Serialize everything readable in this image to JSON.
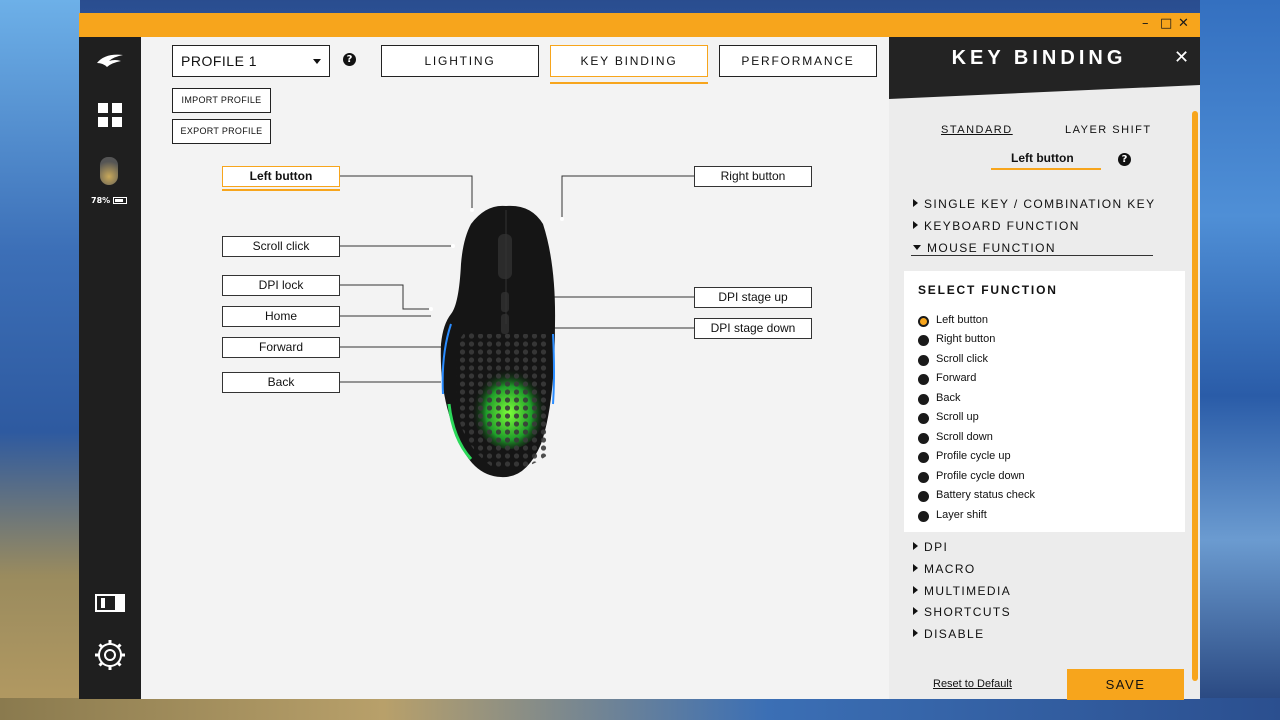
{
  "colors": {
    "accent": "#f7a51c",
    "sidebar": "#1f1f1f",
    "panel_header": "#232323"
  },
  "sidebar": {
    "battery_text": "78%"
  },
  "profile": {
    "selected": "PROFILE 1",
    "import_label": "IMPORT PROFILE",
    "export_label": "EXPORT PROFILE"
  },
  "tabs": [
    {
      "label": "LIGHTING"
    },
    {
      "label": "KEY BINDING"
    },
    {
      "label": "PERFORMANCE"
    }
  ],
  "buttons": {
    "left_button": "Left button",
    "scroll_click": "Scroll click",
    "dpi_lock": "DPI lock",
    "home": "Home",
    "forward": "Forward",
    "back": "Back",
    "right_button": "Right button",
    "dpi_stage_up": "DPI stage up",
    "dpi_stage_down": "DPI stage down"
  },
  "panel": {
    "title": "KEY BINDING",
    "subtabs": [
      {
        "label": "STANDARD"
      },
      {
        "label": "LAYER SHIFT"
      }
    ],
    "current_button": "Left button",
    "categories_top": [
      {
        "label": "SINGLE KEY / COMBINATION KEY"
      },
      {
        "label": "KEYBOARD FUNCTION"
      },
      {
        "label": "MOUSE FUNCTION"
      }
    ],
    "select_title": "SELECT FUNCTION",
    "functions": [
      {
        "label": "Left button"
      },
      {
        "label": "Right button"
      },
      {
        "label": "Scroll click"
      },
      {
        "label": "Forward"
      },
      {
        "label": "Back"
      },
      {
        "label": "Scroll up"
      },
      {
        "label": "Scroll down"
      },
      {
        "label": "Profile cycle up"
      },
      {
        "label": "Profile cycle down"
      },
      {
        "label": "Battery status check"
      },
      {
        "label": "Layer shift"
      }
    ],
    "categories_bottom": [
      {
        "label": "DPI"
      },
      {
        "label": "MACRO"
      },
      {
        "label": "MULTIMEDIA"
      },
      {
        "label": "SHORTCUTS"
      },
      {
        "label": "DISABLE"
      }
    ],
    "reset_label": "Reset to Default",
    "save_label": "SAVE"
  }
}
